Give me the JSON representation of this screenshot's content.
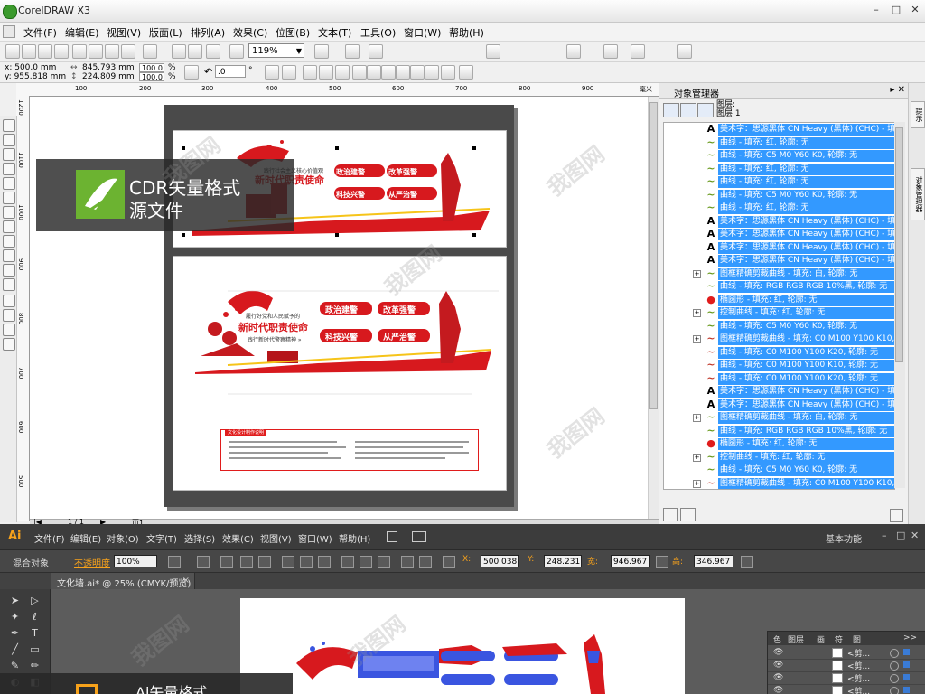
{
  "corel": {
    "title": "CorelDRAW X3",
    "menu": [
      "文件(F)",
      "编辑(E)",
      "视图(V)",
      "版面(L)",
      "排列(A)",
      "效果(C)",
      "位图(B)",
      "文本(T)",
      "工具(O)",
      "窗口(W)",
      "帮助(H)"
    ],
    "zoom": "119%",
    "pos_x": "x: 500.0 mm",
    "pos_y": "y: 955.818 mm",
    "size_w": "845.793 mm",
    "size_h": "224.809 mm",
    "scale_x": "100.0",
    "scale_y": "100.0",
    "scale_unit": "%",
    "rotation": ".0",
    "rotation_unit": "°",
    "ruler_ticks": [
      "100",
      "200",
      "300",
      "400",
      "500",
      "600",
      "700",
      "800",
      "900"
    ],
    "ruler_unit": "毫米",
    "vruler_ticks": [
      "1200",
      "1100",
      "1000",
      "900",
      "800",
      "700",
      "600",
      "500"
    ],
    "page_nav": "1 / 1",
    "page_tab": "页1",
    "badge_line1": "CDR矢量格式",
    "badge_line2": "源文件",
    "object_manager": {
      "title": "对象管理器",
      "layer_label": "图层:",
      "layer_name": "图层 1",
      "items": [
        {
          "icon": "A",
          "color": "#000",
          "text": "美术字：思源黑体 CN Heavy (黑体) (CHC) - 填"
        },
        {
          "icon": "~",
          "color": "#6a9a1e",
          "text": "曲线 - 填充: 红, 轮廓: 无"
        },
        {
          "icon": "~",
          "color": "#6a9a1e",
          "text": "曲线 - 填充: C5 M0 Y60 K0, 轮廓: 无"
        },
        {
          "icon": "~",
          "color": "#6a9a1e",
          "text": "曲线 - 填充: 红, 轮廓: 无"
        },
        {
          "icon": "~",
          "color": "#6a9a1e",
          "text": "曲线 - 填充: 红, 轮廓: 无"
        },
        {
          "icon": "~",
          "color": "#6a9a1e",
          "text": "曲线 - 填充: C5 M0 Y60 K0, 轮廓: 无"
        },
        {
          "icon": "~",
          "color": "#6a9a1e",
          "text": "曲线 - 填充: 红, 轮廓: 无"
        },
        {
          "icon": "A",
          "color": "#000",
          "text": "美术字：思源黑体 CN Heavy (黑体) (CHC) - 填"
        },
        {
          "icon": "A",
          "color": "#000",
          "text": "美术字：思源黑体 CN Heavy (黑体) (CHC) - 填"
        },
        {
          "icon": "A",
          "color": "#000",
          "text": "美术字：思源黑体 CN Heavy (黑体) (CHC) - 填"
        },
        {
          "icon": "A",
          "color": "#000",
          "text": "美术字：思源黑体 CN Heavy (黑体) (CHC) - 填"
        },
        {
          "icon": "~",
          "color": "#6a9a1e",
          "text": "图框精确剪裁曲线 - 填充: 白, 轮廓: 无",
          "expand": true
        },
        {
          "icon": "~",
          "color": "#6a9a1e",
          "text": "曲线 - 填充: RGB RGB RGB 10%黑, 轮廓: 无"
        },
        {
          "icon": "●",
          "color": "#e01c1c",
          "text": "椭圆形 - 填充: 红, 轮廓: 无"
        },
        {
          "icon": "~",
          "color": "#6a9a1e",
          "text": "控制曲线 - 填充: 红, 轮廓: 无",
          "expand": true
        },
        {
          "icon": "~",
          "color": "#6a9a1e",
          "text": "曲线 - 填充: C5 M0 Y60 K0, 轮廓: 无"
        },
        {
          "icon": "~",
          "color": "#c0392b",
          "text": "图框精确剪裁曲线 - 填充: C0 M100 Y100 K10,",
          "expand": true
        },
        {
          "icon": "~",
          "color": "#c0392b",
          "text": "曲线 - 填充: C0 M100 Y100 K20, 轮廓: 无"
        },
        {
          "icon": "~",
          "color": "#c0392b",
          "text": "曲线 - 填充: C0 M100 Y100 K10, 轮廓: 无"
        },
        {
          "icon": "~",
          "color": "#c0392b",
          "text": "曲线 - 填充: C0 M100 Y100 K20, 轮廓: 无"
        },
        {
          "icon": "A",
          "color": "#000",
          "text": "美术字：思源黑体 CN Heavy (黑体) (CHC) - 填"
        },
        {
          "icon": "A",
          "color": "#000",
          "text": "美术字：思源黑体 CN Heavy (黑体) (CHC) - 填"
        },
        {
          "icon": "~",
          "color": "#6a9a1e",
          "text": "图框精确剪裁曲线 - 填充: 白, 轮廓: 无",
          "expand": true
        },
        {
          "icon": "~",
          "color": "#6a9a1e",
          "text": "曲线 - 填充: RGB RGB RGB 10%黑, 轮廓: 无"
        },
        {
          "icon": "●",
          "color": "#e01c1c",
          "text": "椭圆形 - 填充: 红, 轮廓: 无"
        },
        {
          "icon": "~",
          "color": "#6a9a1e",
          "text": "控制曲线 - 填充: 红, 轮廓: 无",
          "expand": true
        },
        {
          "icon": "~",
          "color": "#6a9a1e",
          "text": "曲线 - 填充: C5 M0 Y60 K0, 轮廓: 无"
        },
        {
          "icon": "~",
          "color": "#c0392b",
          "text": "图框精确剪裁曲线 - 填充: C0 M100 Y100 K10,",
          "expand": true
        }
      ]
    },
    "docker_tabs": [
      "提示",
      "对象管理器"
    ]
  },
  "illustrator": {
    "logo": "Ai",
    "menu": [
      "文件(F)",
      "编辑(E)",
      "对象(O)",
      "文字(T)",
      "选择(S)",
      "效果(C)",
      "视图(V)",
      "窗口(W)",
      "帮助(H)"
    ],
    "workspace": "基本功能",
    "ctrl": {
      "mode": "混合对象",
      "opacity_label": "不透明度",
      "opacity": "100%",
      "x": "500.038",
      "y": "248.231",
      "w": "946.967",
      "h": "346.967",
      "w_label": "宽:",
      "h_label": "高:"
    },
    "doc_tab": "文化墙.ai* @ 25% (CMYK/预览)",
    "doc_tab_close": "×",
    "layers": {
      "tabs": [
        "色",
        "图层",
        "画",
        "符",
        "图",
        ">>"
      ],
      "rows": [
        "<剪...",
        "<剪...",
        "<剪...",
        "<剪..."
      ]
    },
    "badge": "Ai矢量格式"
  },
  "artwork": {
    "header1": "践行社会主义核心价值观",
    "slogan": "新时代职责使命",
    "pills": [
      "政治建警",
      "改革强警",
      "科技兴警",
      "从严治警"
    ],
    "banner_b1": "履行好党和人民赋予的",
    "banner_b2": "新时代职责使命",
    "subhead": "践行新时代警察精神 »",
    "info_title": "文化设计制作说明"
  },
  "watermark": "我图网"
}
